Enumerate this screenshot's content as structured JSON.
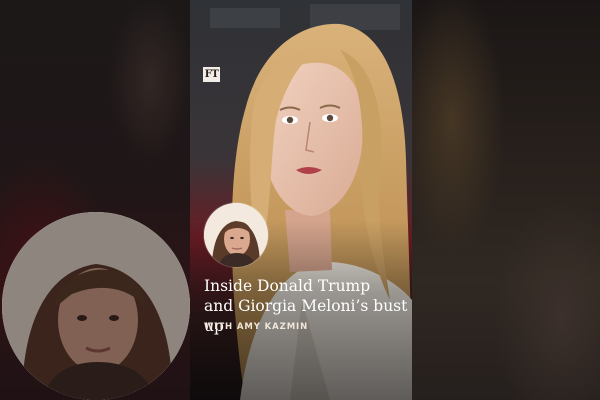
{
  "card": {
    "brand_logo": "FT",
    "title_line1": "Inside Donald Trump",
    "title_line2": "and Giorgia Meloni’s bust up",
    "byline": "WITH AMY KAZMIN"
  },
  "icons": {
    "brand": "ft-logo-icon",
    "host": "host-avatar"
  },
  "colors": {
    "title_text": "#ffffff",
    "byline_text": "#f0e6da",
    "avatar_background": "#f3e9df",
    "backdrop_red": "#5a1d24"
  }
}
